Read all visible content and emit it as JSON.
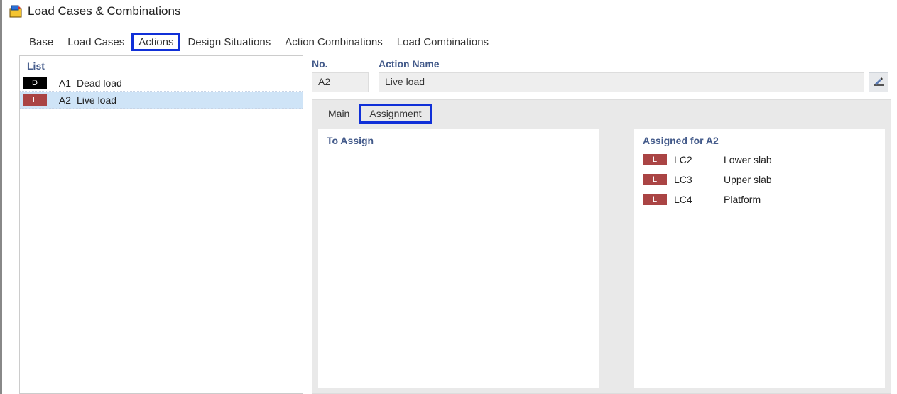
{
  "window": {
    "title": "Load Cases & Combinations"
  },
  "mainTabs": {
    "items": [
      {
        "label": "Base"
      },
      {
        "label": "Load Cases"
      },
      {
        "label": "Actions",
        "highlight": true
      },
      {
        "label": "Design Situations"
      },
      {
        "label": "Action Combinations"
      },
      {
        "label": "Load Combinations"
      }
    ]
  },
  "listPanel": {
    "header": "List",
    "rows": [
      {
        "badge": "D",
        "badgeClass": "badge-d",
        "num": "A1",
        "label": "Dead load",
        "selected": false
      },
      {
        "badge": "L",
        "badgeClass": "badge-l",
        "num": "A2",
        "label": "Live load",
        "selected": true
      }
    ]
  },
  "form": {
    "no_label": "No.",
    "no_value": "A2",
    "name_label": "Action Name",
    "name_value": "Live load"
  },
  "subTabs": {
    "items": [
      {
        "label": "Main"
      },
      {
        "label": "Assignment",
        "highlight": true
      }
    ]
  },
  "assign": {
    "left_header": "To Assign",
    "right_header": "Assigned for A2",
    "assigned": [
      {
        "badge": "L",
        "lc": "LC2",
        "desc": "Lower slab"
      },
      {
        "badge": "L",
        "lc": "LC3",
        "desc": "Upper slab"
      },
      {
        "badge": "L",
        "lc": "LC4",
        "desc": "Platform"
      }
    ]
  }
}
